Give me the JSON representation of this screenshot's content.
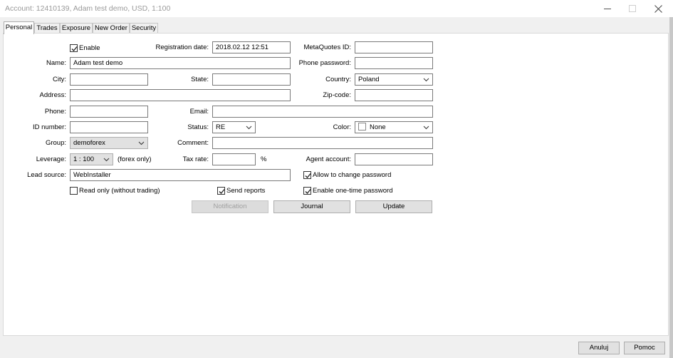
{
  "window": {
    "title": "Account: 12410139, Adam test demo, USD, 1:100"
  },
  "tabs": [
    "Personal",
    "Trades",
    "Exposure",
    "New Order",
    "Security"
  ],
  "form": {
    "enable_label": "Enable",
    "enable_checked": true,
    "registration_date_label": "Registration date:",
    "registration_date_value": "2018.02.12 12:51",
    "metaquotes_label": "MetaQuotes ID:",
    "metaquotes_value": "",
    "name_label": "Name:",
    "name_value": "Adam test demo",
    "phone_password_label": "Phone password:",
    "phone_password_value": "",
    "city_label": "City:",
    "city_value": "",
    "state_label": "State:",
    "state_value": "",
    "country_label": "Country:",
    "country_value": "Poland",
    "address_label": "Address:",
    "address_value": "",
    "zip_label": "Zip-code:",
    "zip_value": "",
    "phone_label": "Phone:",
    "phone_value": "",
    "email_label": "Email:",
    "email_value": "",
    "id_number_label": "ID number:",
    "id_number_value": "",
    "status_label": "Status:",
    "status_value": "RE",
    "color_label": "Color:",
    "color_value": "None",
    "group_label": "Group:",
    "group_value": "demoforex",
    "comment_label": "Comment:",
    "comment_value": "",
    "leverage_label": "Leverage:",
    "leverage_value": "1 : 100",
    "leverage_note": "(forex only)",
    "tax_rate_label": "Tax rate:",
    "tax_rate_value": "",
    "tax_rate_unit": "%",
    "agent_account_label": "Agent account:",
    "agent_account_value": "",
    "lead_source_label": "Lead source:",
    "lead_source_value": "WebInstaller",
    "allow_change_password_label": "Allow to change password",
    "allow_change_password_checked": true,
    "read_only_label": "Read only (without trading)",
    "read_only_checked": false,
    "send_reports_label": "Send reports",
    "send_reports_checked": true,
    "one_time_password_label": "Enable one-time password",
    "one_time_password_checked": true
  },
  "actions": {
    "notification": "Notification",
    "journal": "Journal",
    "update": "Update"
  },
  "footer": {
    "cancel": "Anuluj",
    "help": "Pomoc"
  },
  "icons": {
    "minimize": "minimize-icon",
    "maximize": "maximize-icon",
    "close": "close-icon",
    "check": "check-icon",
    "dropdown": "chevron-down-icon"
  }
}
